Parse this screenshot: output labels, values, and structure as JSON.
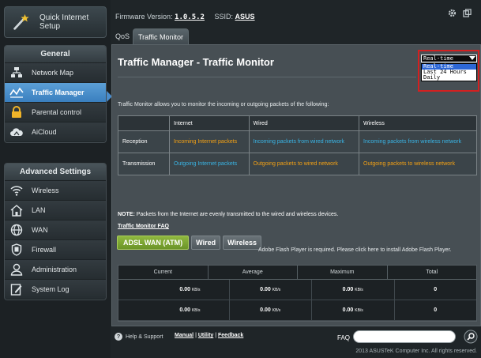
{
  "sidebar": {
    "quick_setup": "Quick Internet Setup",
    "general_header": "General",
    "general_items": [
      {
        "label": "Network Map",
        "icon": "network-map-icon"
      },
      {
        "label": "Traffic Manager",
        "icon": "traffic-manager-icon",
        "active": true
      },
      {
        "label": "Parental control",
        "icon": "lock-icon"
      },
      {
        "label": "AiCloud",
        "icon": "cloud-icon"
      }
    ],
    "advanced_header": "Advanced Settings",
    "advanced_items": [
      {
        "label": "Wireless",
        "icon": "wifi-icon"
      },
      {
        "label": "LAN",
        "icon": "house-icon"
      },
      {
        "label": "WAN",
        "icon": "globe-icon"
      },
      {
        "label": "Firewall",
        "icon": "shield-icon"
      },
      {
        "label": "Administration",
        "icon": "user-icon"
      },
      {
        "label": "System Log",
        "icon": "log-icon"
      }
    ]
  },
  "header": {
    "firmware_label": "Firmware Version:",
    "firmware_version": "1.0.5.2",
    "ssid_label": "SSID:",
    "ssid_value": "ASUS",
    "tabs": [
      "QoS",
      "Traffic Monitor"
    ]
  },
  "main": {
    "title": "Traffic Manager - Traffic Monitor",
    "select_value": "Real-time",
    "select_options": [
      "Real-time",
      "Last 24 Hours",
      "Daily"
    ],
    "description": "Traffic Monitor allows you to monitor the incoming or outgoing packets of the following:",
    "table_headers": [
      "",
      "Internet",
      "Wired",
      "Wireless"
    ],
    "table_rows": [
      {
        "label": "Reception",
        "internet": "Incoming Internet packets",
        "wired": "Incoming packets from wired network",
        "wireless": "Incoming packets from wireless network"
      },
      {
        "label": "Transmission",
        "internet": "Outgoing Internet packets",
        "wired": "Outgoing packets to wired network",
        "wireless": "Outgoing packets to wireless network"
      }
    ],
    "note_label": "NOTE:",
    "note_text": "Packets from the Internet are evenly transmitted to the wired and wireless devices.",
    "faq_link": "Traffic Monitor FAQ",
    "buttons": [
      "ADSL WAN (ATM)",
      "Wired",
      "Wireless"
    ],
    "flash_notice": "Adobe Flash Player is required. Please click here to install Adobe Flash Player.",
    "stats_headers": [
      "Current",
      "Average",
      "Maximum",
      "Total"
    ],
    "stats_rows": [
      {
        "current": "0.00",
        "average": "0.00",
        "maximum": "0.00",
        "total": "0"
      },
      {
        "current": "0.00",
        "average": "0.00",
        "maximum": "0.00",
        "total": "0"
      }
    ],
    "unit": "KB/s"
  },
  "footer": {
    "help": "Help & Support",
    "manual": "Manual",
    "utility": "Utility",
    "feedback": "Feedback",
    "faq_label": "FAQ",
    "copyright": "2013 ASUSTeK Computer Inc. All rights reserved."
  },
  "colors": {
    "accent": "#4a8ccb",
    "orange_text": "#f5a214",
    "cyan_text": "#39b5e6",
    "highlight_box": "#d32020"
  }
}
